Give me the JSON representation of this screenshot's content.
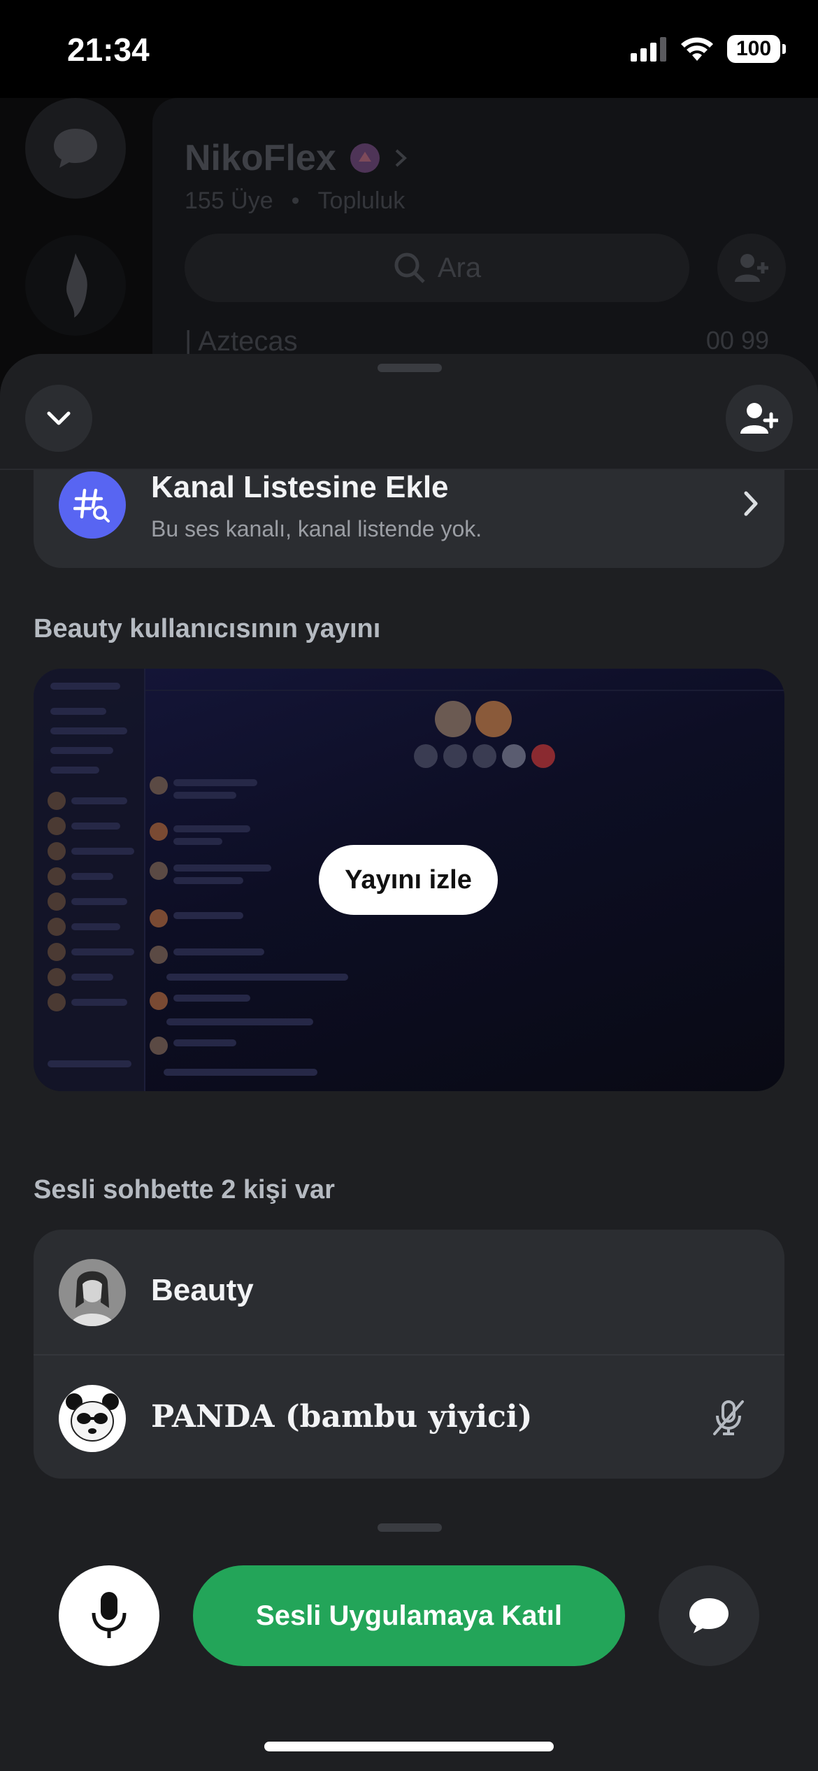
{
  "status_bar": {
    "time": "21:34",
    "battery": "100"
  },
  "background": {
    "server_name": "NikoFlex",
    "members": "155 Üye",
    "separator": "•",
    "community": "Topluluk",
    "search_placeholder": "Ara",
    "channel_partial": "| Aztecas",
    "channel_counts": "00  99"
  },
  "add_to_list": {
    "title": "Kanal Listesine Ekle",
    "subtitle": "Bu ses kanalı, kanal listende yok."
  },
  "stream": {
    "label": "Beauty kullanıcısının yayını",
    "watch_button": "Yayını izle"
  },
  "voice": {
    "count_label": "Sesli sohbette 2 kişi var",
    "members": [
      {
        "name": "Beauty",
        "muted": false
      },
      {
        "name": "PANDA (bambu yiyici)",
        "muted": true
      }
    ]
  },
  "controls": {
    "join_button": "Sesli Uygulamaya Katıl"
  },
  "colors": {
    "accent": "#5865f2",
    "join_green": "#23a559",
    "sheet_bg": "#1e1f22",
    "card_bg": "#2b2d31"
  },
  "icons": [
    "chat-bubble-icon",
    "flame-icon",
    "search-icon",
    "add-member-icon",
    "chevron-down-icon",
    "hashtag-search-icon",
    "chevron-right-icon",
    "mute-mic-icon",
    "microphone-icon"
  ]
}
